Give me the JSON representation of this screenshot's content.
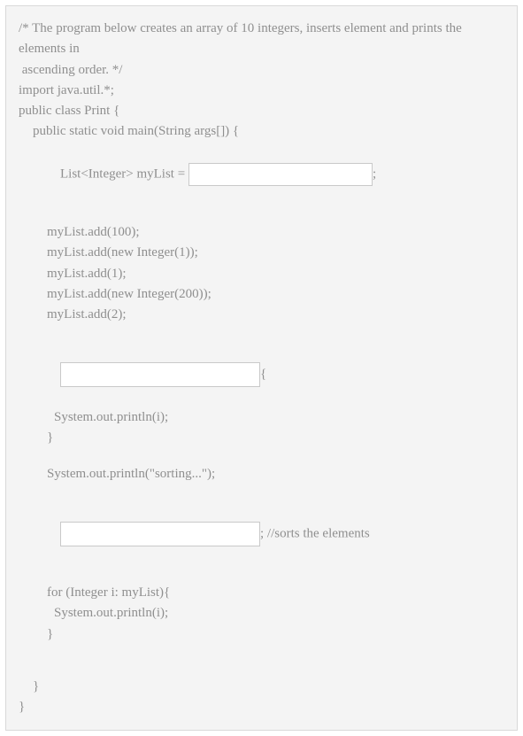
{
  "comment1": "/* The program below creates an array of 10 integers, inserts element and prints the elements in",
  "comment2": " ascending order. */",
  "l_import": "import java.util.*;",
  "l_class": "public class Print {",
  "l_main": "public static void main(String args[]) {",
  "l_listdecl_pre": "List<Integer> myList = ",
  "l_listdecl_post": ";",
  "blank1_value": "",
  "adds": [
    "myList.add(100);",
    "myList.add(new Integer(1));",
    "myList.add(1);",
    "myList.add(new Integer(200));",
    "myList.add(2);"
  ],
  "blank2_value": "",
  "l_for_post": "{",
  "l_println_i": "System.out.println(i);",
  "l_close_brace": "}",
  "l_sorting": "System.out.println(\"sorting...\");",
  "blank3_value": "",
  "l_sort_post": "; //sorts the elements",
  "l_for2": "for (Integer i: myList){",
  "l_println_i2": "System.out.println(i);",
  "l_close_brace2": "}",
  "l_close_main": "}",
  "l_close_class": "}"
}
